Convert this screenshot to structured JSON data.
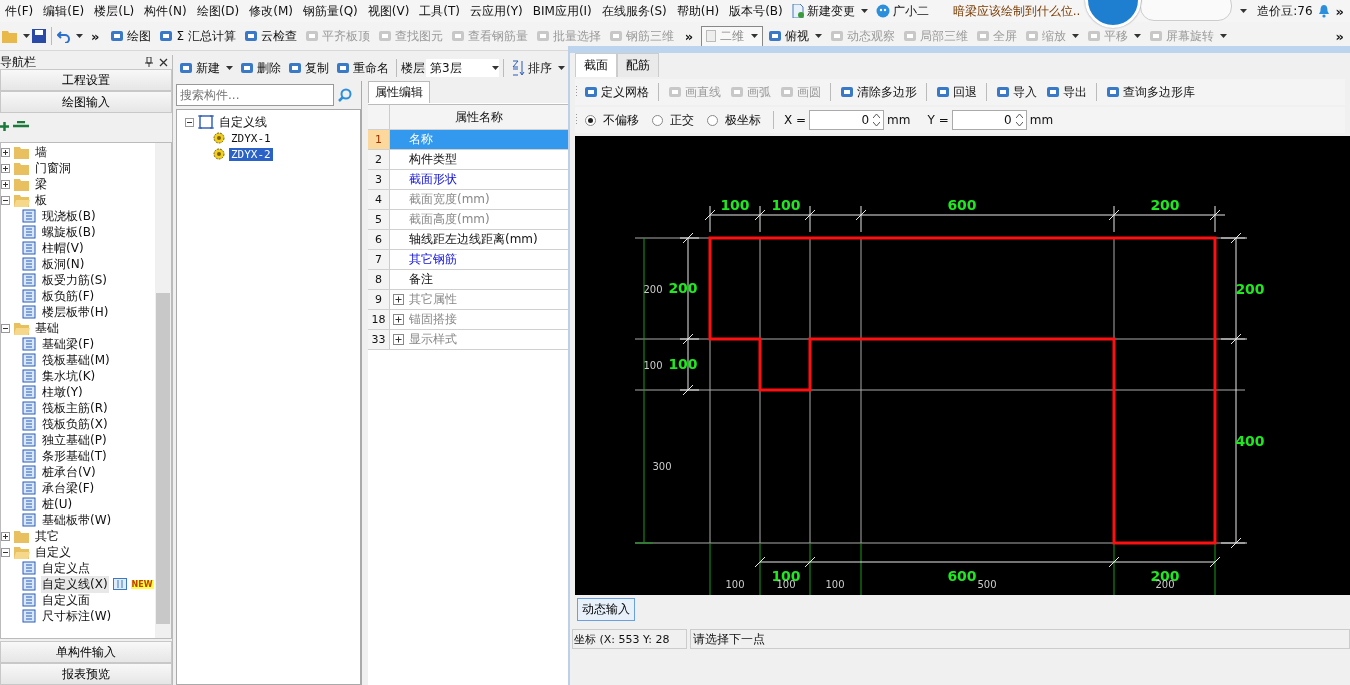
{
  "menu_bar": {
    "items": [
      "件(F)",
      "编辑(E)",
      "楼层(L)",
      "构件(N)",
      "绘图(D)",
      "修改(M)",
      "钢筋量(Q)",
      "视图(V)",
      "工具(T)",
      "云应用(Y)",
      "BIM应用(I)",
      "在线服务(S)",
      "帮助(H)",
      "版本号(B)"
    ],
    "extras": [
      {
        "label": "新建变更",
        "kind": "dropdown"
      },
      {
        "label": "广小二",
        "kind": "assistant"
      }
    ],
    "question": "暗梁应该绘制到什么位..",
    "coins": "造价豆:76",
    "more": "»"
  },
  "toolbar": {
    "more_left": "»",
    "left": [
      {
        "label": "绘图",
        "disabled": false
      },
      {
        "label": "Σ 汇总计算",
        "disabled": false
      },
      {
        "label": "云检查",
        "disabled": false
      },
      {
        "label": "平齐板顶",
        "disabled": true
      },
      {
        "label": "查找图元",
        "disabled": true
      },
      {
        "label": "查看钢筋量",
        "disabled": true
      },
      {
        "label": "批量选择",
        "disabled": true
      },
      {
        "label": "钢筋三维",
        "disabled": true
      }
    ],
    "more_mid": "»",
    "view_mode": "二维",
    "right": [
      {
        "label": "俯视",
        "kind": "dropdown",
        "disabled": false
      },
      {
        "label": "动态观察",
        "disabled": true
      },
      {
        "label": "局部三维",
        "disabled": true
      },
      {
        "label": "全屏",
        "disabled": true
      },
      {
        "label": "缩放",
        "kind": "dropdown",
        "disabled": true
      },
      {
        "label": "平移",
        "kind": "dropdown",
        "disabled": true
      },
      {
        "label": "屏幕旋转",
        "kind": "dropdown",
        "disabled": true
      }
    ],
    "more_right": "»"
  },
  "navigator": {
    "title": "导航栏",
    "top_sections": [
      "工程设置",
      "绘图输入"
    ],
    "tree": [
      {
        "label": "墙",
        "expanded": false
      },
      {
        "label": "门窗洞",
        "expanded": false
      },
      {
        "label": "梁",
        "expanded": false
      },
      {
        "label": "板",
        "expanded": true,
        "children": [
          {
            "label": "现浇板(B)",
            "selected": false
          },
          {
            "label": "螺旋板(B)",
            "selected": false
          },
          {
            "label": "柱帽(V)",
            "selected": false
          },
          {
            "label": "板洞(N)",
            "selected": false
          },
          {
            "label": "板受力筋(S)",
            "selected": false
          },
          {
            "label": "板负筋(F)",
            "selected": false
          },
          {
            "label": "楼层板带(H)",
            "selected": false
          }
        ]
      },
      {
        "label": "基础",
        "expanded": true,
        "children": [
          {
            "label": "基础梁(F)",
            "selected": false
          },
          {
            "label": "筏板基础(M)",
            "selected": false
          },
          {
            "label": "集水坑(K)",
            "selected": false
          },
          {
            "label": "柱墩(Y)",
            "selected": false
          },
          {
            "label": "筏板主筋(R)",
            "selected": false
          },
          {
            "label": "筏板负筋(X)",
            "selected": false
          },
          {
            "label": "独立基础(P)",
            "selected": false
          },
          {
            "label": "条形基础(T)",
            "selected": false
          },
          {
            "label": "桩承台(V)",
            "selected": false
          },
          {
            "label": "承台梁(F)",
            "selected": false
          },
          {
            "label": "桩(U)",
            "selected": false
          },
          {
            "label": "基础板带(W)",
            "selected": false
          }
        ]
      },
      {
        "label": "其它",
        "expanded": false
      },
      {
        "label": "自定义",
        "expanded": true,
        "children": [
          {
            "label": "自定义点",
            "selected": false
          },
          {
            "label": "自定义线(X)",
            "selected": true,
            "badge": "NEW"
          },
          {
            "label": "自定义面",
            "selected": false
          },
          {
            "label": "尺寸标注(W)",
            "selected": false
          }
        ]
      }
    ],
    "bottom_sections": [
      "单构件输入",
      "报表预览"
    ]
  },
  "component_toolbar": {
    "items": [
      {
        "label": "新建",
        "kind": "dropdown"
      },
      {
        "label": "删除"
      },
      {
        "label": "复制"
      },
      {
        "label": "重命名"
      }
    ],
    "floor_label": "楼层",
    "floor": "第3层",
    "sort": "排序"
  },
  "component_list": {
    "search": {
      "placeholder": "搜索构件..."
    },
    "tree": [
      {
        "label": "自定义线",
        "expanded": true,
        "children": [
          {
            "label": "ZDYX-1",
            "selected": false
          },
          {
            "label": "ZDYX-2",
            "selected": true
          }
        ]
      }
    ]
  },
  "properties": {
    "tab": "属性编辑",
    "header": "属性名称",
    "rows": [
      {
        "no": "1",
        "name": "名称",
        "kind": "link",
        "selected": true,
        "expandable": false
      },
      {
        "no": "2",
        "name": "构件类型",
        "kind": "normal",
        "selected": false,
        "expandable": false
      },
      {
        "no": "3",
        "name": "截面形状",
        "kind": "link",
        "selected": false,
        "expandable": false
      },
      {
        "no": "4",
        "name": "截面宽度(mm)",
        "kind": "muted",
        "selected": false,
        "expandable": false
      },
      {
        "no": "5",
        "name": "截面高度(mm)",
        "kind": "muted",
        "selected": false,
        "expandable": false
      },
      {
        "no": "6",
        "name": "轴线距左边线距离(mm)",
        "kind": "normal",
        "selected": false,
        "expandable": false
      },
      {
        "no": "7",
        "name": "其它钢筋",
        "kind": "link",
        "selected": false,
        "expandable": false
      },
      {
        "no": "8",
        "name": "备注",
        "kind": "normal",
        "selected": false,
        "expandable": false
      },
      {
        "no": "9",
        "name": "其它属性",
        "kind": "muted",
        "selected": false,
        "expandable": true
      },
      {
        "no": "18",
        "name": "锚固搭接",
        "kind": "muted",
        "selected": false,
        "expandable": true
      },
      {
        "no": "33",
        "name": "显示样式",
        "kind": "muted",
        "selected": false,
        "expandable": true
      }
    ]
  },
  "editor": {
    "tabs": [
      {
        "label": "截面",
        "selected": true
      },
      {
        "label": "配筋",
        "selected": false
      }
    ],
    "tools": [
      {
        "label": "定义网格",
        "disabled": false
      },
      {
        "label": "画直线",
        "disabled": true
      },
      {
        "label": "画弧",
        "disabled": true
      },
      {
        "label": "画圆",
        "disabled": true
      },
      {
        "label": "清除多边形",
        "disabled": false
      },
      {
        "label": "回退",
        "disabled": false
      },
      {
        "label": "导入",
        "disabled": false
      },
      {
        "label": "导出",
        "disabled": false
      },
      {
        "label": "查询多边形库",
        "disabled": false
      }
    ],
    "modes": [
      {
        "label": "不偏移",
        "selected": true
      },
      {
        "label": "正交",
        "selected": false
      },
      {
        "label": "极坐标",
        "selected": false
      }
    ],
    "coords": [
      {
        "label": "X =",
        "value": "0",
        "unit": "mm"
      },
      {
        "label": "Y =",
        "value": "0",
        "unit": "mm"
      }
    ],
    "canvas": {
      "top_dimensions": [
        "100",
        "100",
        "600",
        "200"
      ],
      "right_dimensions": [
        "200",
        "400"
      ],
      "left_dimensions": [
        "200",
        "100"
      ],
      "left_dimensions_green": [
        "200",
        "100"
      ],
      "left_extra": "300",
      "bottom_dimensions": [
        "100",
        "600",
        "200"
      ],
      "bottom_grid": [
        "100",
        "100",
        "100",
        "500",
        "200"
      ]
    },
    "dynamic_input": "动态输入",
    "status": {
      "coords": "坐标 (X: 553 Y: 28",
      "prompt": "请选择下一点"
    }
  }
}
